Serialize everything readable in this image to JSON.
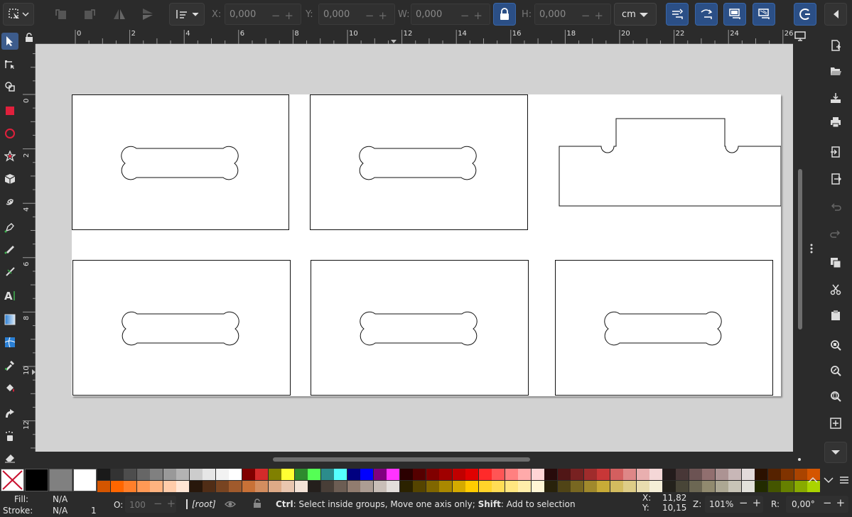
{
  "toolbar": {
    "x_label": "X:",
    "x_value": "0,000",
    "y_label": "Y:",
    "y_value": "0,000",
    "w_label": "W:",
    "w_value": "0,000",
    "h_label": "H:",
    "h_value": "0,000",
    "unit": "cm"
  },
  "ruler": {
    "top_ticks": [
      "0",
      "2",
      "4",
      "6",
      "8",
      "10",
      "12",
      "14",
      "16",
      "18",
      "20",
      "22",
      "24",
      "26"
    ],
    "left_ticks": [
      "0",
      "2",
      "4",
      "6",
      "8",
      "10",
      "12"
    ]
  },
  "status": {
    "fill_label": "Fill:",
    "fill_value": "N/A",
    "stroke_label": "Stroke:",
    "stroke_value": "N/A",
    "stroke_width": "1",
    "opacity_label": "O:",
    "opacity_value": "100",
    "layer": "[root]",
    "message_ctrl": "Ctrl",
    "message_ctrl_text": ": Select inside groups, Move one axis only; ",
    "message_shift": "Shift",
    "message_shift_text": ": Add to selection",
    "cursor_x_label": "X:",
    "cursor_x": "11,82",
    "cursor_y_label": "Y:",
    "cursor_y": "10,15",
    "zoom_label": "Z:",
    "zoom": "101%",
    "rotation_label": "R:",
    "rotation": "0,00°"
  },
  "colors": {
    "accent": "#2b4f86",
    "canvas_bg": "#d2d2d2",
    "page_bg": "#ffffff",
    "ui_bg": "#2b2b2b"
  },
  "palette": {
    "row1": [
      "#1a1a1a",
      "#333333",
      "#4d4d4d",
      "#666666",
      "#808080",
      "#999999",
      "#b3b3b3",
      "#cccccc",
      "#e6e6e6",
      "#f2f2f2",
      "#ffffff",
      "#800000",
      "#d42a2a",
      "#808000",
      "#ffff33",
      "#2e8b2e",
      "#55ff55",
      "#2c8c8c",
      "#55ffff",
      "#000080",
      "#0000ff",
      "#800080",
      "#ff33ff",
      "#2b0000",
      "#550000",
      "#800000",
      "#a00000",
      "#c00000",
      "#e00000",
      "#ff2a2a",
      "#ff5555",
      "#ff8080",
      "#ffaaaa",
      "#ffd5d5",
      "#280b0b",
      "#501616",
      "#782121",
      "#a02c2c",
      "#c83737",
      "#d35f5f",
      "#de8787",
      "#e9afaf",
      "#f4d7d7",
      "#241c1c",
      "#483737",
      "#6c5353",
      "#916f6f",
      "#ac9393",
      "#c8b7b7",
      "#e3dbdb",
      "#2b1100",
      "#552200",
      "#803300",
      "#aa4400",
      "#d45500"
    ],
    "row2": [
      "#d45500",
      "#ff6600",
      "#ff7f2a",
      "#ff9955",
      "#ffb380",
      "#ffccaa",
      "#ffe6d5",
      "#28170b",
      "#502d16",
      "#784421",
      "#a05a2c",
      "#c87137",
      "#d38d5f",
      "#deaa87",
      "#e9c6af",
      "#f4e3d7",
      "#241f1c",
      "#483e37",
      "#6c5d53",
      "#917c6f",
      "#ac9d93",
      "#c8beb7",
      "#e3dedb",
      "#2b2200",
      "#554400",
      "#806600",
      "#aa8800",
      "#d4aa00",
      "#ffcc00",
      "#ffd42a",
      "#ffdd55",
      "#ffe680",
      "#ffeeaa",
      "#fff6d5",
      "#28220b",
      "#504416",
      "#786721",
      "#a0892c",
      "#c8ab37",
      "#d3bc5f",
      "#decd87",
      "#e9ddaf",
      "#f4eed7",
      "#24221c",
      "#484537",
      "#6c6753",
      "#918a6f",
      "#aca793",
      "#c8c4b7",
      "#e3e2db",
      "#222b00",
      "#445500",
      "#668000",
      "#88aa00",
      "#aad400"
    ]
  }
}
